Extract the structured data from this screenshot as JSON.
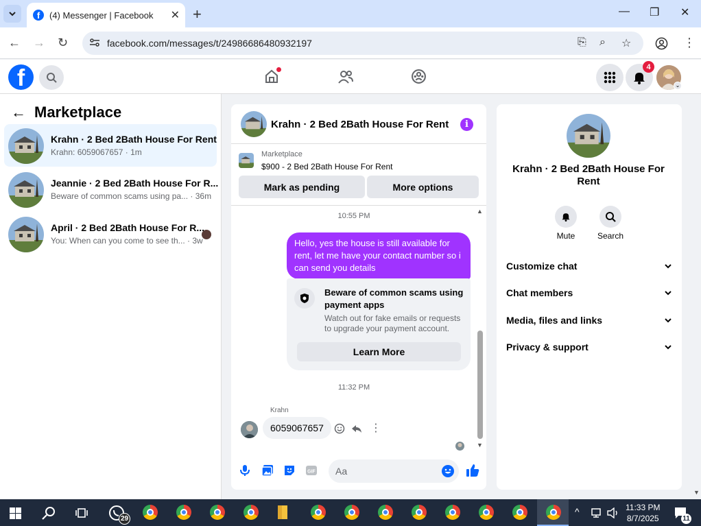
{
  "browser": {
    "tab_title": "(4) Messenger | Facebook",
    "url": "facebook.com/messages/t/24986686480932197"
  },
  "fb": {
    "notif_count": "4"
  },
  "left": {
    "title": "Marketplace",
    "conversations": [
      {
        "title": "Krahn · 2 Bed 2Bath House For Rent",
        "snippet": "Krahn: 6059067657 · 1m"
      },
      {
        "title": "Jeannie · 2 Bed 2Bath House For R...",
        "snippet": "Beware of common scams using pa... · 36m"
      },
      {
        "title": "April · 2 Bed 2Bath House For R...",
        "snippet": "You: When can you come to see th... · 3w"
      }
    ]
  },
  "chat": {
    "title": "Krahn · 2 Bed 2Bath House For Rent",
    "listing_category": "Marketplace",
    "listing_line": "$900 - 2 Bed 2Bath House For Rent",
    "btn_pending": "Mark as pending",
    "btn_more": "More options",
    "ts1": "10:55 PM",
    "out_msg": "Hello, yes the house is still available for rent, let me have your contact number so i can send you  details",
    "card_title": "Beware of common scams using payment apps",
    "card_desc": "Watch out for fake emails or requests to upgrade your payment account.",
    "card_btn": "Learn More",
    "ts2": "11:32 PM",
    "sender": "Krahn",
    "in_msg": "6059067657",
    "placeholder": "Aa"
  },
  "right": {
    "name": "Krahn · 2 Bed 2Bath House For Rent",
    "mute": "Mute",
    "search": "Search",
    "sections": [
      "Customize chat",
      "Chat members",
      "Media, files and links",
      "Privacy & support"
    ]
  },
  "taskbar": {
    "whatsapp_badge": "29",
    "notif_count": "11",
    "time": "11:33 PM",
    "date": "8/7/2025"
  },
  "colors": {
    "accent": "#a033ff",
    "fb_blue": "#0866ff"
  }
}
